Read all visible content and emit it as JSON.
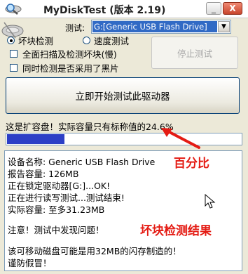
{
  "window": {
    "title": "MyDiskTest (版本 2.19)"
  },
  "titlebar": {
    "minimize_glyph": "_",
    "close_glyph": "X"
  },
  "device": {
    "label": "测试:",
    "selected": "G:[Generic USB Flash Drive]"
  },
  "modes": [
    {
      "label": "坏块检测",
      "selected": true
    },
    {
      "label": "速度测试",
      "selected": false
    }
  ],
  "options": [
    {
      "label": "全面扫描及检测坏块(慢)",
      "checked": false
    },
    {
      "label": "同时检测是否采用了黑片",
      "checked": false
    }
  ],
  "buttons": {
    "stop": "停止测试",
    "start": "立即开始测试此驱动器"
  },
  "status": {
    "message": "这是扩容盘！实际容量只有标称值的24.6%",
    "progress_percent": 24.6
  },
  "results": {
    "lines": [
      "设备名称: Generic USB Flash Drive",
      "报告容量: 126MB",
      "正在锁定驱动器[G:]...OK!",
      "正在进行读写测试...测试结束!",
      "实际容量: 至多31.23MB",
      "",
      "注意！测试中发现问题！",
      "",
      "该可移动磁盘可能是用32MB的闪存制造的！",
      "谨防假冒！"
    ]
  },
  "annotations": {
    "percent": "百分比",
    "bad_block_result": "坏块检测结果",
    "color": "#e41b13"
  },
  "icons": {
    "app": "magnifier-disk-icon",
    "disk": "disk-drive-icon",
    "dropdown": "chevron-down-icon",
    "cursor": "mouse-cursor-icon"
  },
  "colors": {
    "progress": "#2c3fc6",
    "selection": "#316ac5"
  }
}
